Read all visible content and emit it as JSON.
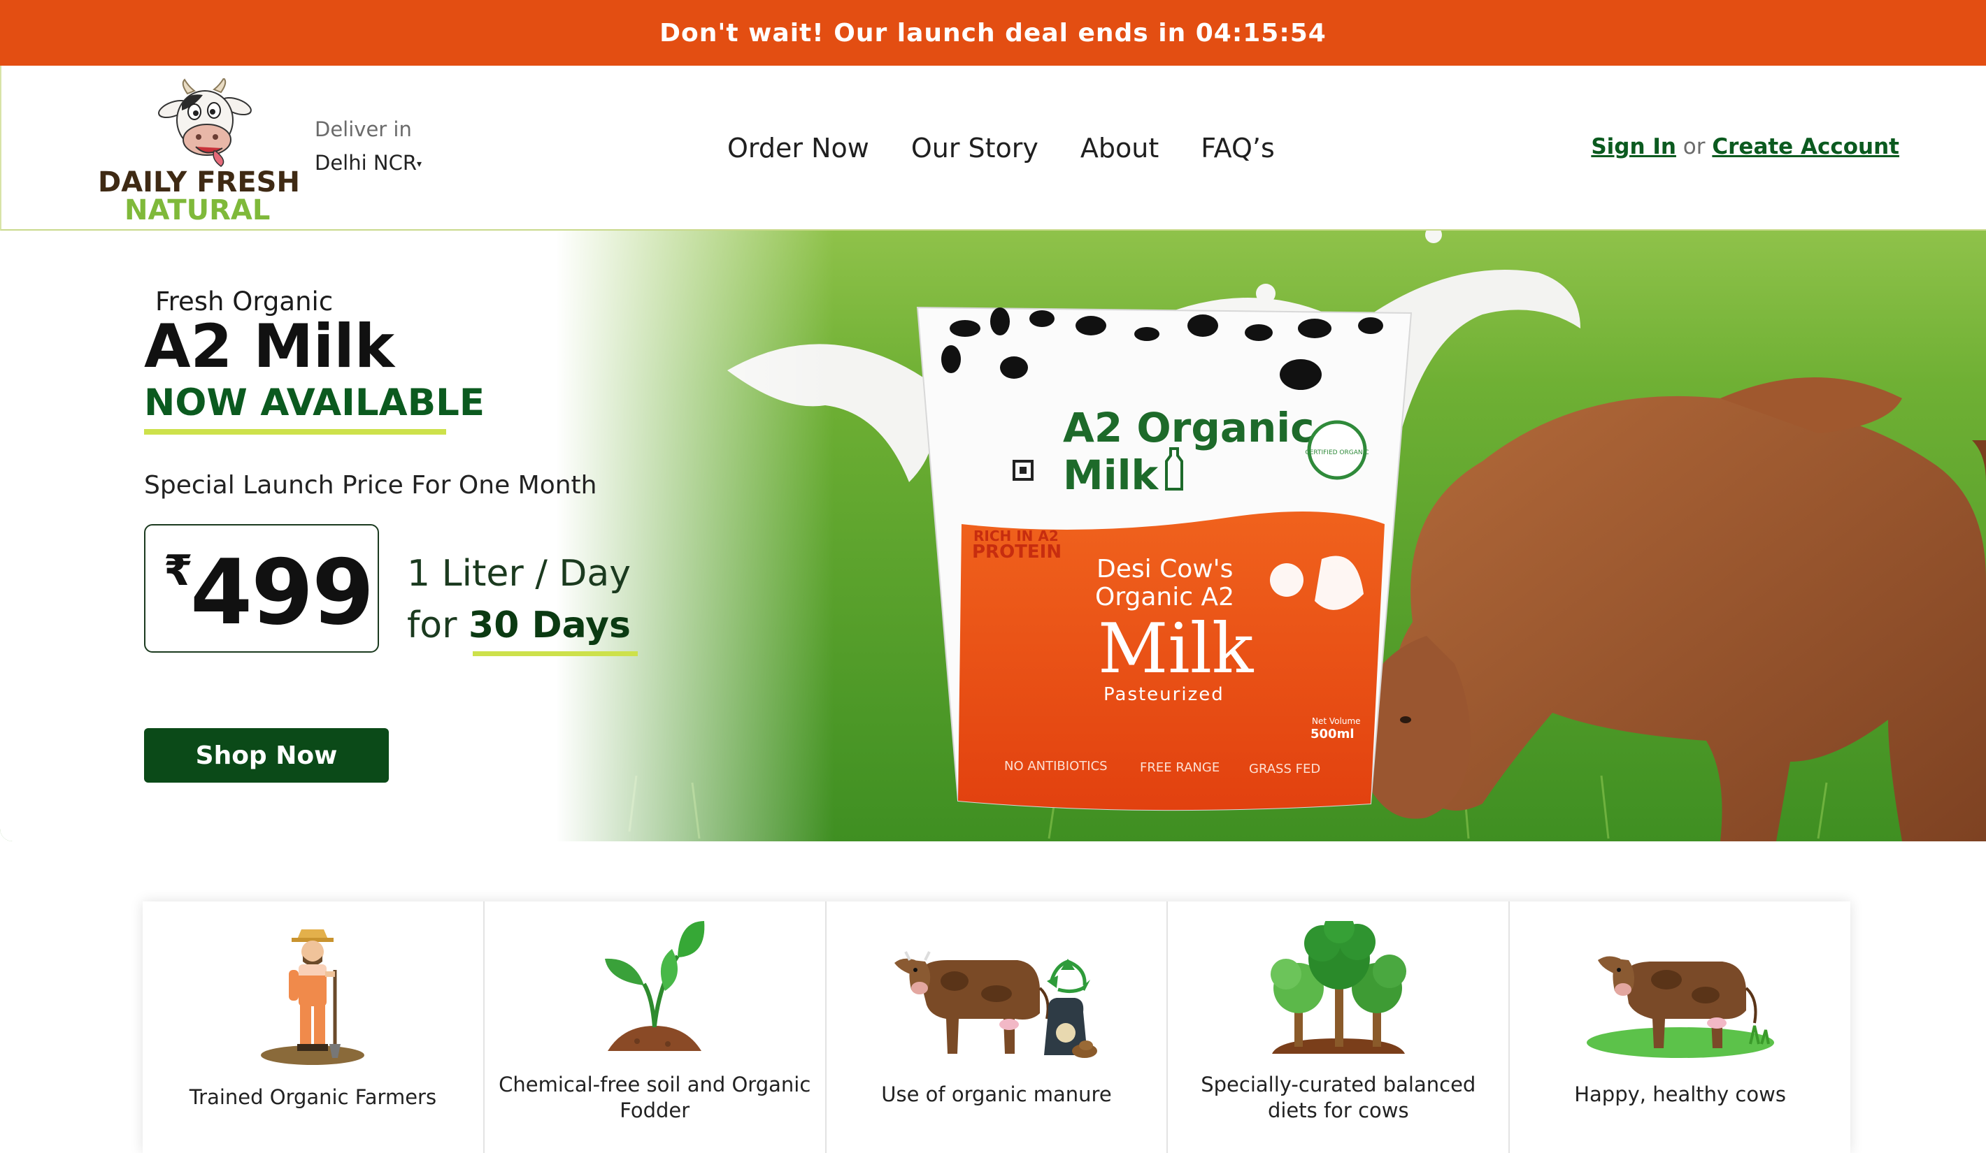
{
  "announcement": {
    "text": "Don't wait! Our launch deal ends in 04:15:54"
  },
  "header": {
    "logo": {
      "line1": "DAILY FRESH",
      "line2": "NATURAL"
    },
    "deliver": {
      "label": "Deliver in",
      "location": "Delhi NCR"
    },
    "nav": [
      "Order Now",
      "Our Story",
      "About",
      "FAQ’s"
    ],
    "auth": {
      "sign_in": "Sign In",
      "or": "or",
      "create_account": "Create Account"
    }
  },
  "hero": {
    "kicker": "Fresh Organic",
    "headline": "A2 Milk",
    "availability": "NOW AVAILABLE",
    "special_text": "Special Launch Price For One Month",
    "price": {
      "currency": "₹",
      "amount": "499"
    },
    "per_line1": "1 Liter / Day",
    "per_line2_prefix": "for ",
    "per_line2_bold": "30 Days",
    "cta": "Shop Now",
    "package": {
      "title_line1": "A2 Organic",
      "title_line2": "Milk",
      "badge": "CERTIFIED ORGANIC",
      "protein_line1": "RICH IN A2",
      "protein_line2": "PROTEIN",
      "desc_line1": "Desi Cow's",
      "desc_line2": "Organic A2",
      "desc_line3": "Milk",
      "desc_line4": "Pasteurized",
      "volume_label": "Net Volume",
      "volume": "500ml",
      "tag1": "NO ANTIBIOTICS",
      "tag2": "FREE RANGE",
      "tag3": "GRASS FED"
    }
  },
  "features": [
    {
      "icon": "farmer-icon",
      "caption": "Trained Organic Farmers"
    },
    {
      "icon": "plant-sprout-icon",
      "caption": "Chemical-free soil and Organic Fodder"
    },
    {
      "icon": "cow-manure-icon",
      "caption": "Use of organic manure"
    },
    {
      "icon": "trees-icon",
      "caption": "Specially-curated balanced diets for cows"
    },
    {
      "icon": "cow-on-grass-icon",
      "caption": "Happy, healthy cows"
    }
  ],
  "colors": {
    "announcement_bg": "#e34e12",
    "brand_green": "#0b5a1f",
    "accent_lime": "#cde14b",
    "brand_brown": "#3f2a14"
  }
}
